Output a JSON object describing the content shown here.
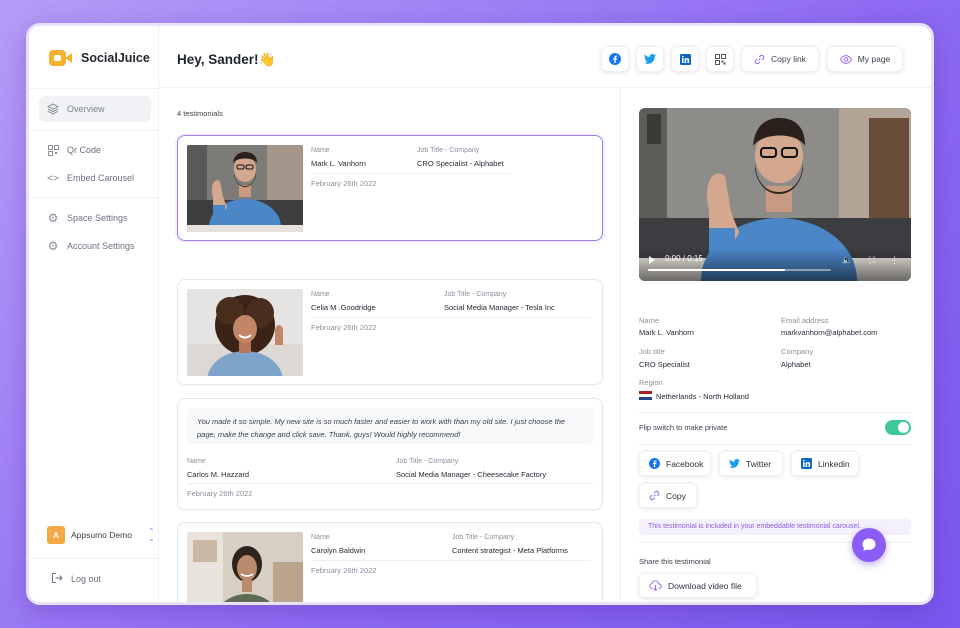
{
  "app": {
    "name": "SocialJuice"
  },
  "sidebar": {
    "items": [
      {
        "label": "Overview",
        "icon": "layers-icon",
        "active": true
      },
      {
        "label": "Qr Code",
        "icon": "qr-code-icon"
      },
      {
        "label": "Embed Carousel",
        "icon": "code-icon"
      },
      {
        "label": "Space Settings",
        "icon": "gear-icon"
      },
      {
        "label": "Account Settings",
        "icon": "gear-icon"
      }
    ],
    "account": {
      "initial": "A",
      "name": "Appsumo Demo"
    },
    "logout": "Log out"
  },
  "header": {
    "greeting": "Hey, Sander!👋",
    "share": {
      "copy_link": "Copy link",
      "my_page": "My page"
    }
  },
  "list": {
    "count": "4 testimonials",
    "name_label": "Name",
    "job_label": "Job Title - Company",
    "cards": [
      {
        "name": "Mark L. Vanhorn",
        "job": "CRO Specialist - Alphabet",
        "date": "February 26th 2022"
      },
      {
        "name": "Celia M .Goodridge",
        "job": "Social Media Manager - Tesla Inc",
        "date": "February 26th 2022"
      },
      {
        "quote": "You made it so simple. My new site is so much faster and easier to work with than my old site. I just choose the page, make the change and click save. Thank, guys! Would highly recommend!",
        "name": "Carlos M. Hazzard",
        "job": "Social Media Manager - Cheesecake Factory",
        "date": "February 26th 2022"
      },
      {
        "name": "Carolyn Baldwin",
        "job": "Content strategist - Meta Platforms",
        "date": "February 26th 2022"
      }
    ]
  },
  "detail": {
    "video": {
      "time": "0:00 / 0:15",
      "progress": 0.75
    },
    "fields": {
      "name_label": "Name",
      "name": "Mark L. Vanhorn",
      "email_label": "Email address",
      "email": "markvanhorn@alphabet.com",
      "job_label": "Job title",
      "job": "CRO Specialist",
      "company_label": "Company",
      "company": "Alphabet",
      "region_label": "Region",
      "region": "Netherlands - North Holland"
    },
    "private_toggle": {
      "label": "Flip switch to make private",
      "on": true
    },
    "share_buttons": {
      "facebook": "Facebook",
      "twitter": "Twitter",
      "linkedin": "Linkedin",
      "copy": "Copy"
    },
    "notice": "This testimonial is included in your embeddable testimonial carousel.",
    "share_label": "Share this testimonial",
    "download": "Download video file"
  },
  "colors": {
    "accent": "#8b5cf6",
    "toggle_on": "#3dc79b",
    "facebook": "#1877f2",
    "twitter": "#1d9bf0",
    "linkedin": "#0a66c2"
  }
}
